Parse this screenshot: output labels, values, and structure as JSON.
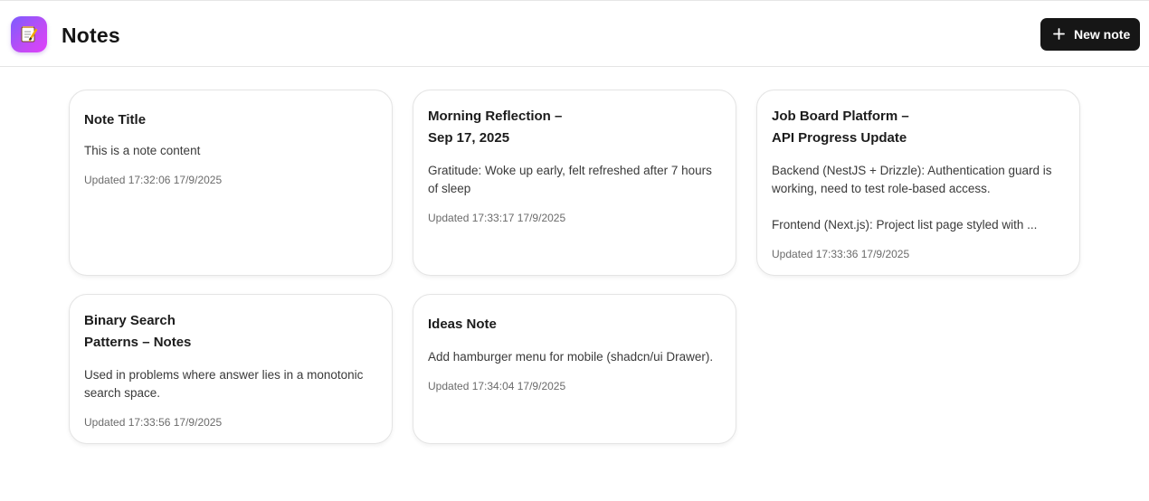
{
  "header": {
    "title": "Notes",
    "new_note_label": "New note",
    "logo_icon": "memo-icon",
    "brand_gradient": [
      "#7c5cff",
      "#e040fb"
    ]
  },
  "notes": [
    {
      "title": "Note Title",
      "content": "This is a note content",
      "updated": "Updated 17:32:06 17/9/2025"
    },
    {
      "title": "Morning Reflection –\nSep 17, 2025",
      "content": "Gratitude: Woke up early, felt refreshed after 7 hours of sleep",
      "updated": "Updated 17:33:17 17/9/2025"
    },
    {
      "title": "Job Board Platform –\nAPI Progress Update",
      "content": "Backend (NestJS + Drizzle): Authentication guard is working, need to test role-based access.\n\nFrontend (Next.js): Project list page styled with ...",
      "updated": "Updated 17:33:36 17/9/2025"
    },
    {
      "title": "Binary Search\nPatterns – Notes",
      "content": "Used in problems where answer lies in a monotonic search space.",
      "updated": "Updated 17:33:56 17/9/2025"
    },
    {
      "title": "Ideas Note",
      "content": "Add hamburger menu for mobile (shadcn/ui Drawer).",
      "updated": "Updated 17:34:04 17/9/2025"
    }
  ]
}
